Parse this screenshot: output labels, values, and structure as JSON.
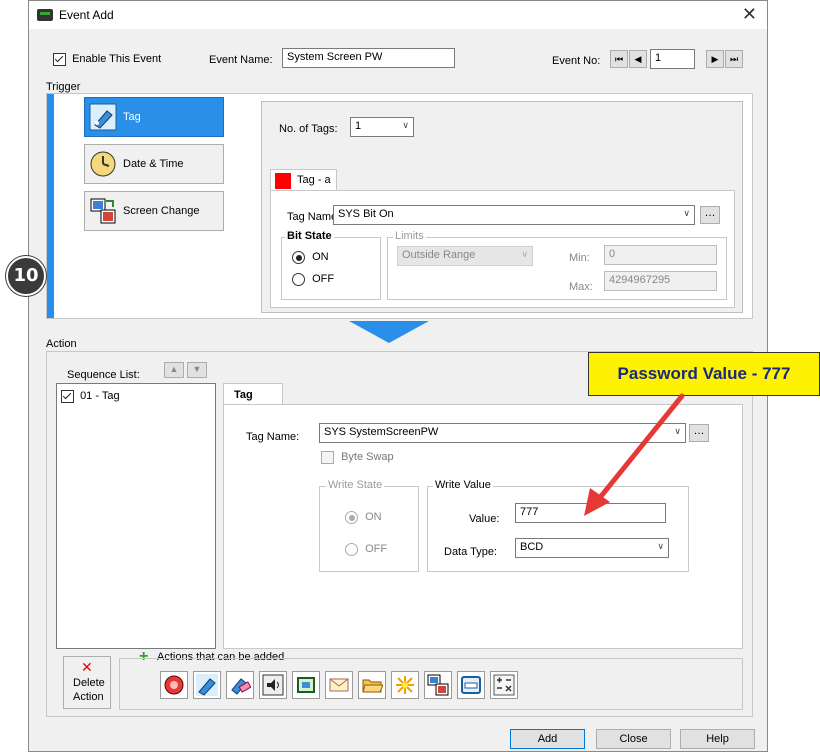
{
  "window": {
    "title": "Event Add",
    "close_glyph": "✕"
  },
  "header": {
    "enable_label": "Enable This Event",
    "enable_checked": true,
    "event_name_label": "Event Name:",
    "event_name_value": "System Screen PW",
    "event_no_label": "Event No:",
    "event_no_value": "1"
  },
  "trigger": {
    "section_label": "Trigger",
    "buttons": [
      {
        "label": "Tag",
        "icon": "tag-icon",
        "selected": true
      },
      {
        "label": "Date & Time",
        "icon": "clock-icon",
        "selected": false
      },
      {
        "label": "Screen Change",
        "icon": "screen-change-icon",
        "selected": false
      }
    ],
    "no_of_tags_label": "No. of Tags:",
    "no_of_tags_value": "1",
    "tab_label": "Tag - a",
    "tag_name_label": "Tag Name:",
    "tag_name_value": "SYS Bit On",
    "bit_state_label": "Bit State",
    "on_label": "ON",
    "off_label": "OFF",
    "limits_label": "Limits",
    "limits_mode": "Outside Range",
    "min_label": "Min:",
    "min_value": "0",
    "max_label": "Max:",
    "max_value": "4294967295"
  },
  "badge": {
    "number": "10"
  },
  "action": {
    "section_label": "Action",
    "sequence_list_label": "Sequence List:",
    "sequence_items": [
      {
        "label": "01 - Tag",
        "checked": true
      }
    ],
    "tab_label": "Tag",
    "tag_name_label": "Tag Name:",
    "tag_name_value": "SYS SystemScreenPW",
    "byte_swap_label": "Byte Swap",
    "write_state_label": "Write State",
    "on_label": "ON",
    "off_label": "OFF",
    "write_value_label": "Write Value",
    "value_label": "Value:",
    "value_value": "777",
    "data_type_label": "Data Type:",
    "data_type_value": "BCD",
    "delete_line1": "Delete",
    "delete_line2": "Action",
    "actions_can_add_label": "Actions that can be added",
    "action_icons": [
      "alarm-icon",
      "tag-icon",
      "tag-erase-icon",
      "sound-icon",
      "screenshot-icon",
      "mail-icon",
      "folder-icon",
      "flash-icon",
      "screen-change-icon",
      "window-icon",
      "calc-icon"
    ]
  },
  "callout": {
    "text": "Password Value - 777"
  },
  "footer": {
    "add_label": "Add",
    "close_label": "Close",
    "help_label": "Help"
  },
  "colors": {
    "accent": "#2a8fe8",
    "callout_bg": "#fff200",
    "arrow": "#e53935",
    "badge": "#3a3a3a",
    "tag_swatch": "#ff0000"
  }
}
